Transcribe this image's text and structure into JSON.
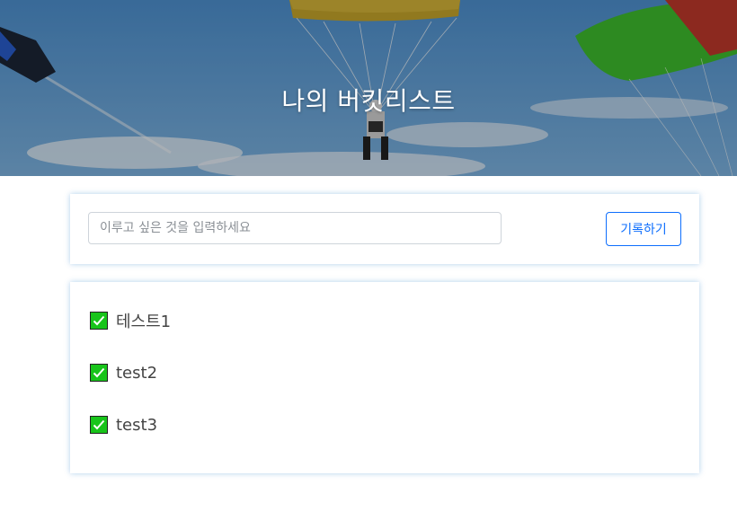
{
  "header": {
    "title": "나의 버킷리스트"
  },
  "form": {
    "input_placeholder": "이루고 싶은 것을 입력하세요",
    "input_value": "",
    "submit_label": "기록하기"
  },
  "bucket_list": {
    "items": [
      {
        "text": "테스트1",
        "done": true
      },
      {
        "text": "test2",
        "done": true
      },
      {
        "text": "test3",
        "done": true
      }
    ]
  },
  "colors": {
    "accent": "#0d6efd",
    "check": "#18c41a"
  }
}
